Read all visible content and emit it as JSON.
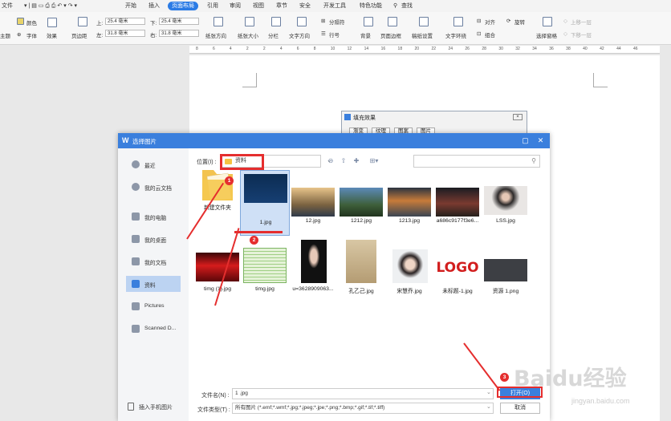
{
  "menubar": {
    "file": "文件",
    "tabs": [
      "开始",
      "插入",
      "页面布局",
      "引用",
      "审阅",
      "视图",
      "章节",
      "安全",
      "开发工具",
      "特色功能"
    ],
    "active_tab": "页面布局",
    "search": "查找"
  },
  "toolbar": {
    "theme": "主题",
    "color": "颜色",
    "font": "字体",
    "effect": "效果",
    "margin": "页边距",
    "top_label": "上:",
    "top_value": "25.4 毫米",
    "bottom_label": "下:",
    "bottom_value": "25.4 毫米",
    "left_label": "左:",
    "left_value": "31.8 毫米",
    "right_label": "右:",
    "right_value": "31.8 毫米",
    "orientation": "纸张方向",
    "size": "纸张大小",
    "columns": "分栏",
    "text_direction": "文字方向",
    "section_break": "分隔符",
    "line_number": "行号",
    "background": "背景",
    "page_border": "页面边框",
    "paper_setting": "稿纸设置",
    "wrap": "文字环绕",
    "align": "对齐",
    "rotate": "旋转",
    "group": "组合",
    "selection_pane": "选择窗格",
    "bring_forward": "上移一层",
    "send_backward": "下移一层"
  },
  "ruler": [
    "8",
    "6",
    "4",
    "2",
    "2",
    "4",
    "6",
    "8",
    "10",
    "12",
    "14",
    "16",
    "18",
    "20",
    "22",
    "24",
    "26",
    "28",
    "30",
    "32",
    "34",
    "36",
    "38",
    "40",
    "42",
    "44",
    "46"
  ],
  "fill_dialog": {
    "title": "填充效果",
    "tabs": [
      "渐变",
      "纹理",
      "图案",
      "图片"
    ]
  },
  "dialog": {
    "title": "选择图片",
    "location_label": "位置(I) :",
    "location_value": "资料",
    "sidebar": [
      {
        "label": "最近",
        "icon": "clock-icon"
      },
      {
        "label": "我的云文档",
        "icon": "cloud-icon"
      },
      {
        "label": "我的电脑",
        "icon": "computer-icon"
      },
      {
        "label": "我的桌面",
        "icon": "desktop-icon"
      },
      {
        "label": "我的文档",
        "icon": "folder-icon"
      },
      {
        "label": "资料",
        "icon": "folder-icon"
      },
      {
        "label": "Pictures",
        "icon": "folder-icon"
      },
      {
        "label": "Scanned D...",
        "icon": "folder-icon"
      }
    ],
    "active_sidebar": "资料",
    "insert_phone": "插入手机图片",
    "files_row1": [
      "新建文件夹",
      "1.jpg",
      "12.jpg",
      "1212.jpg",
      "1213.jpg",
      "a686c9177f3e6...",
      "LSS.jpg"
    ],
    "files_row2": [
      "timg (1).jpg",
      "timg.jpg",
      "u=3628909063...",
      "孔乙己.jpg",
      "宋慧乔.jpg",
      "未标题-1.jpg",
      "资源 1.png"
    ],
    "logo_text": "LOGO",
    "filename_label": "文件名(N) :",
    "filename_value": "1 .jpg",
    "filetype_label": "文件类型(T) :",
    "filetype_value": "所有图片 (*.emf;*.wmf;*.jpg;*.jpeg;*.jpe;*.png;*.bmp;*.gif;*.tif;*.tiff)",
    "open_button": "打开(O)",
    "cancel_button": "取消"
  },
  "annotations": {
    "step1": "1",
    "step2": "2",
    "step3": "3"
  },
  "watermark": {
    "main": "Baidu经验",
    "sub": "jingyan.baidu.com"
  },
  "colors": {
    "accent": "#3a7fdd",
    "annotation": "#e52e2e",
    "folder": "#f5c342"
  }
}
